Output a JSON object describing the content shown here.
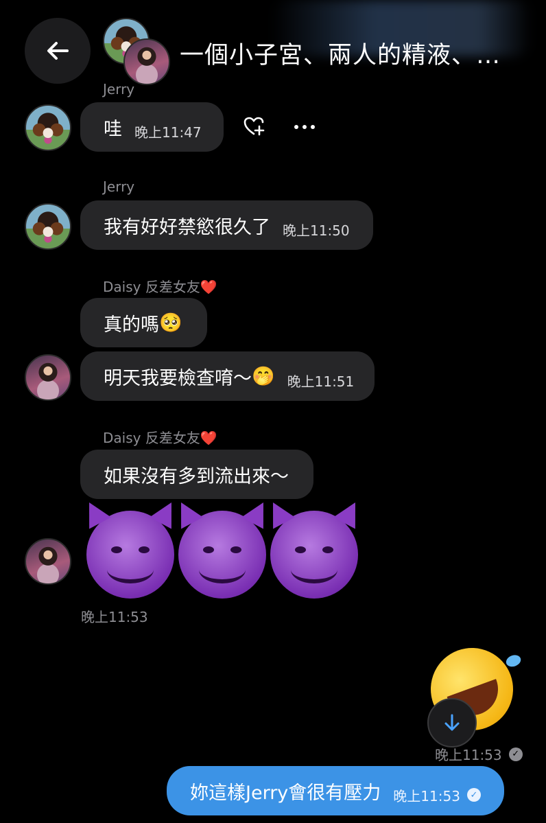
{
  "header": {
    "title": "一個小子宮、兩人的精液、…"
  },
  "messages": {
    "m1": {
      "sender": "Jerry",
      "text": "哇",
      "time": "晚上11:47"
    },
    "m2": {
      "sender": "Jerry",
      "text": "我有好好禁慾很久了",
      "time": "晚上11:50"
    },
    "m3": {
      "sender": "Daisy 反差女友",
      "sender_emoji": "❤️",
      "text": "真的嗎",
      "text_emoji": "🥺"
    },
    "m4": {
      "text": "明天我要檢查唷～",
      "text_emoji": "🤭",
      "time": "晚上11:51"
    },
    "m5": {
      "sender": "Daisy 反差女友",
      "sender_emoji": "❤️",
      "text": "如果沒有多到流出來～"
    },
    "m6": {
      "emoji_count": 3,
      "emoji": "smiling-imp",
      "time": "晚上11:53"
    },
    "m7": {
      "emoji": "rolling-on-floor-laughing",
      "time": "晚上11:53"
    },
    "m8": {
      "text": "妳這樣Jerry會很有壓力",
      "time": "晚上11:53"
    }
  },
  "colors": {
    "background": "#000000",
    "bubble_incoming": "#262628",
    "bubble_outgoing": "#3c93e6"
  }
}
